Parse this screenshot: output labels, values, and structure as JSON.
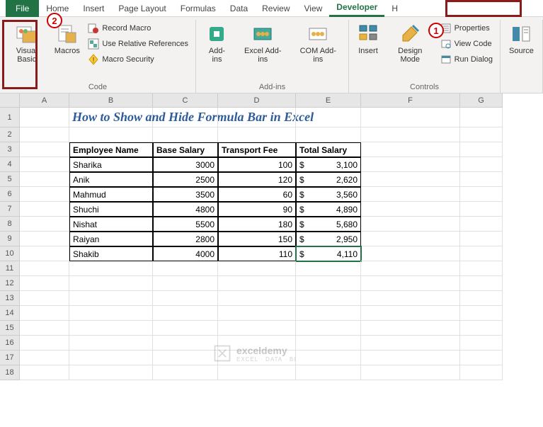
{
  "tabs": {
    "file": "File",
    "home": "Home",
    "insert": "Insert",
    "pageLayout": "Page Layout",
    "formulas": "Formulas",
    "data": "Data",
    "review": "Review",
    "view": "View",
    "developer": "Developer",
    "help": "H"
  },
  "ribbon": {
    "code": {
      "visualBasic": "Visual Basic",
      "macros": "Macros",
      "recordMacro": "Record Macro",
      "useRelative": "Use Relative References",
      "macroSecurity": "Macro Security",
      "groupLabel": "Code"
    },
    "addins": {
      "addins": "Add-ins",
      "excelAddins": "Excel Add-ins",
      "comAddins": "COM Add-ins",
      "groupLabel": "Add-ins"
    },
    "controls": {
      "insert": "Insert",
      "designMode": "Design Mode",
      "properties": "Properties",
      "viewCode": "View Code",
      "runDialog": "Run Dialog",
      "groupLabel": "Controls"
    },
    "source": {
      "source": "Source"
    }
  },
  "columns": [
    "A",
    "B",
    "C",
    "D",
    "E",
    "F",
    "G"
  ],
  "rows": [
    "1",
    "2",
    "3",
    "4",
    "5",
    "6",
    "7",
    "8",
    "9",
    "10",
    "11",
    "12",
    "13",
    "14",
    "15",
    "16",
    "17",
    "18"
  ],
  "title": "How to Show and Hide Formula Bar in Excel",
  "headers": {
    "name": "Employee Name",
    "base": "Base Salary",
    "transport": "Transport Fee",
    "total": "Total Salary"
  },
  "data": [
    {
      "name": "Sharika",
      "base": "3000",
      "transport": "100",
      "total": "$      3,100"
    },
    {
      "name": "Anik",
      "base": "2500",
      "transport": "120",
      "total": "$      2,620"
    },
    {
      "name": "Mahmud",
      "base": "3500",
      "transport": "60",
      "total": "$      3,560"
    },
    {
      "name": "Shuchi",
      "base": "4800",
      "transport": "90",
      "total": "$      4,890"
    },
    {
      "name": "Nishat",
      "base": "5500",
      "transport": "180",
      "total": "$      5,680"
    },
    {
      "name": "Raiyan",
      "base": "2800",
      "transport": "150",
      "total": "$      2,950"
    },
    {
      "name": "Shakib",
      "base": "4000",
      "transport": "110",
      "total": "$      4,110"
    }
  ],
  "watermark": {
    "brand": "exceldemy",
    "tagline": "EXCEL · DATA · BI"
  },
  "markers": {
    "m1": "1",
    "m2": "2"
  }
}
